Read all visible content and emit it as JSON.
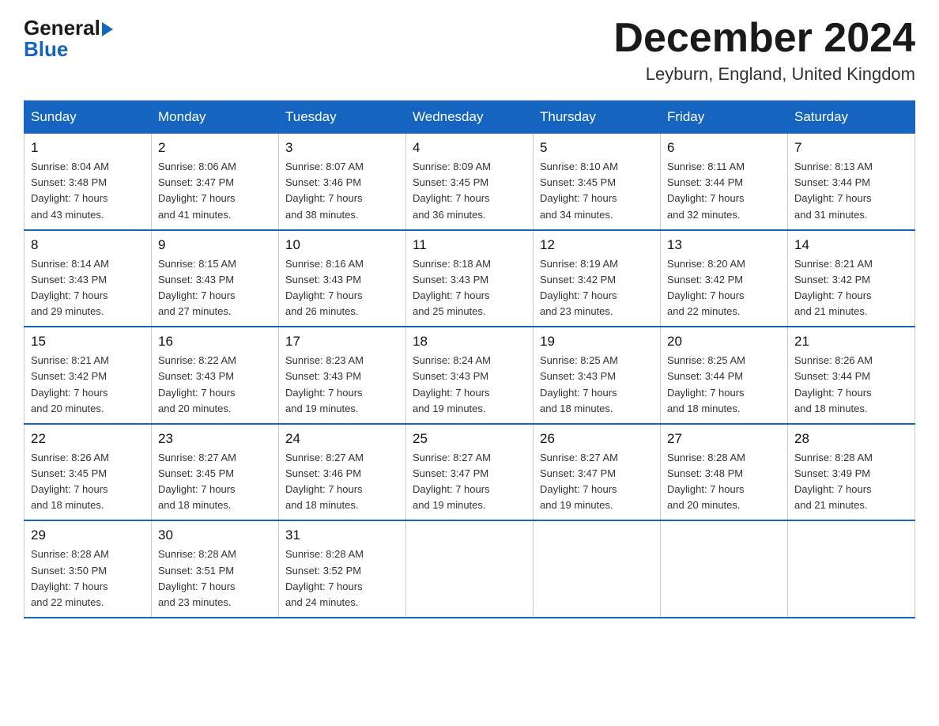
{
  "header": {
    "logo_general": "General",
    "logo_blue": "Blue",
    "month_title": "December 2024",
    "location": "Leyburn, England, United Kingdom"
  },
  "days_of_week": [
    "Sunday",
    "Monday",
    "Tuesday",
    "Wednesday",
    "Thursday",
    "Friday",
    "Saturday"
  ],
  "weeks": [
    [
      {
        "day": "1",
        "sunrise": "8:04 AM",
        "sunset": "3:48 PM",
        "daylight": "7 hours and 43 minutes."
      },
      {
        "day": "2",
        "sunrise": "8:06 AM",
        "sunset": "3:47 PM",
        "daylight": "7 hours and 41 minutes."
      },
      {
        "day": "3",
        "sunrise": "8:07 AM",
        "sunset": "3:46 PM",
        "daylight": "7 hours and 38 minutes."
      },
      {
        "day": "4",
        "sunrise": "8:09 AM",
        "sunset": "3:45 PM",
        "daylight": "7 hours and 36 minutes."
      },
      {
        "day": "5",
        "sunrise": "8:10 AM",
        "sunset": "3:45 PM",
        "daylight": "7 hours and 34 minutes."
      },
      {
        "day": "6",
        "sunrise": "8:11 AM",
        "sunset": "3:44 PM",
        "daylight": "7 hours and 32 minutes."
      },
      {
        "day": "7",
        "sunrise": "8:13 AM",
        "sunset": "3:44 PM",
        "daylight": "7 hours and 31 minutes."
      }
    ],
    [
      {
        "day": "8",
        "sunrise": "8:14 AM",
        "sunset": "3:43 PM",
        "daylight": "7 hours and 29 minutes."
      },
      {
        "day": "9",
        "sunrise": "8:15 AM",
        "sunset": "3:43 PM",
        "daylight": "7 hours and 27 minutes."
      },
      {
        "day": "10",
        "sunrise": "8:16 AM",
        "sunset": "3:43 PM",
        "daylight": "7 hours and 26 minutes."
      },
      {
        "day": "11",
        "sunrise": "8:18 AM",
        "sunset": "3:43 PM",
        "daylight": "7 hours and 25 minutes."
      },
      {
        "day": "12",
        "sunrise": "8:19 AM",
        "sunset": "3:42 PM",
        "daylight": "7 hours and 23 minutes."
      },
      {
        "day": "13",
        "sunrise": "8:20 AM",
        "sunset": "3:42 PM",
        "daylight": "7 hours and 22 minutes."
      },
      {
        "day": "14",
        "sunrise": "8:21 AM",
        "sunset": "3:42 PM",
        "daylight": "7 hours and 21 minutes."
      }
    ],
    [
      {
        "day": "15",
        "sunrise": "8:21 AM",
        "sunset": "3:42 PM",
        "daylight": "7 hours and 20 minutes."
      },
      {
        "day": "16",
        "sunrise": "8:22 AM",
        "sunset": "3:43 PM",
        "daylight": "7 hours and 20 minutes."
      },
      {
        "day": "17",
        "sunrise": "8:23 AM",
        "sunset": "3:43 PM",
        "daylight": "7 hours and 19 minutes."
      },
      {
        "day": "18",
        "sunrise": "8:24 AM",
        "sunset": "3:43 PM",
        "daylight": "7 hours and 19 minutes."
      },
      {
        "day": "19",
        "sunrise": "8:25 AM",
        "sunset": "3:43 PM",
        "daylight": "7 hours and 18 minutes."
      },
      {
        "day": "20",
        "sunrise": "8:25 AM",
        "sunset": "3:44 PM",
        "daylight": "7 hours and 18 minutes."
      },
      {
        "day": "21",
        "sunrise": "8:26 AM",
        "sunset": "3:44 PM",
        "daylight": "7 hours and 18 minutes."
      }
    ],
    [
      {
        "day": "22",
        "sunrise": "8:26 AM",
        "sunset": "3:45 PM",
        "daylight": "7 hours and 18 minutes."
      },
      {
        "day": "23",
        "sunrise": "8:27 AM",
        "sunset": "3:45 PM",
        "daylight": "7 hours and 18 minutes."
      },
      {
        "day": "24",
        "sunrise": "8:27 AM",
        "sunset": "3:46 PM",
        "daylight": "7 hours and 18 minutes."
      },
      {
        "day": "25",
        "sunrise": "8:27 AM",
        "sunset": "3:47 PM",
        "daylight": "7 hours and 19 minutes."
      },
      {
        "day": "26",
        "sunrise": "8:27 AM",
        "sunset": "3:47 PM",
        "daylight": "7 hours and 19 minutes."
      },
      {
        "day": "27",
        "sunrise": "8:28 AM",
        "sunset": "3:48 PM",
        "daylight": "7 hours and 20 minutes."
      },
      {
        "day": "28",
        "sunrise": "8:28 AM",
        "sunset": "3:49 PM",
        "daylight": "7 hours and 21 minutes."
      }
    ],
    [
      {
        "day": "29",
        "sunrise": "8:28 AM",
        "sunset": "3:50 PM",
        "daylight": "7 hours and 22 minutes."
      },
      {
        "day": "30",
        "sunrise": "8:28 AM",
        "sunset": "3:51 PM",
        "daylight": "7 hours and 23 minutes."
      },
      {
        "day": "31",
        "sunrise": "8:28 AM",
        "sunset": "3:52 PM",
        "daylight": "7 hours and 24 minutes."
      },
      null,
      null,
      null,
      null
    ]
  ],
  "labels": {
    "sunrise": "Sunrise:",
    "sunset": "Sunset:",
    "daylight": "Daylight:"
  }
}
